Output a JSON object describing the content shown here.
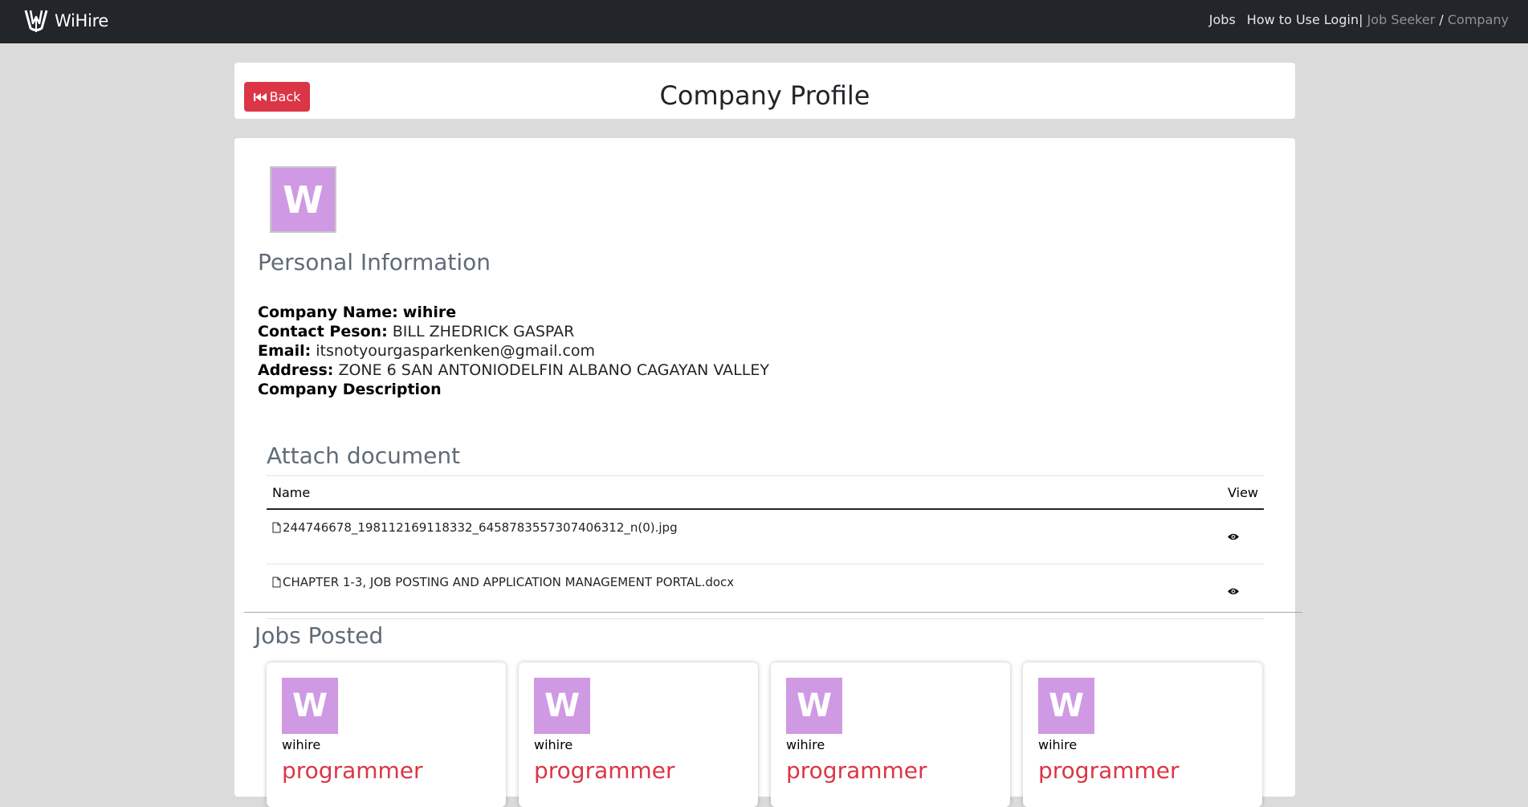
{
  "navbar": {
    "brand": "WiHire",
    "links": {
      "jobs": "Jobs",
      "how_to_use": "How to Use",
      "login": "Login|",
      "job_seeker": "Job Seeker",
      "slash": "/",
      "company": "Company"
    }
  },
  "header": {
    "back_label": "Back",
    "title": "Company Profile"
  },
  "profile": {
    "avatar_letter": "W",
    "avatar_color": "#cf99e3",
    "section_title": "Personal Information",
    "company_name_label": "Company Name:",
    "company_name": "wihire",
    "contact_label": "Contact Peson:",
    "contact": "BILL ZHEDRICK GASPAR",
    "email_label": "Email:",
    "email": "itsnotyourgasparkenken@gmail.com",
    "address_label": "Address:",
    "address": "ZONE 6 SAN ANTONIODELFIN ALBANO CAGAYAN VALLEY",
    "description_label": "Company Description"
  },
  "documents": {
    "title": "Attach document",
    "columns": {
      "name": "Name",
      "view": "View"
    },
    "files": [
      {
        "name": "244746678_198112169118332_6458783557307406312_n(0).jpg",
        "icon": "file-icon"
      },
      {
        "name": "CHAPTER 1-3, JOB POSTING AND APPLICATION MANAGEMENT PORTAL.docx",
        "icon": "file-icon"
      }
    ]
  },
  "jobs": {
    "title": "Jobs Posted",
    "cards": [
      {
        "letter": "W",
        "company": "wihire",
        "title": "programmer"
      },
      {
        "letter": "W",
        "company": "wihire",
        "title": "programmer"
      },
      {
        "letter": "W",
        "company": "wihire",
        "title": "programmer"
      },
      {
        "letter": "W",
        "company": "wihire",
        "title": "programmer"
      }
    ]
  },
  "colors": {
    "navbar": "#222529",
    "danger": "#dc3545",
    "avatar": "#cf99e3",
    "background": "#dcdbdc"
  }
}
